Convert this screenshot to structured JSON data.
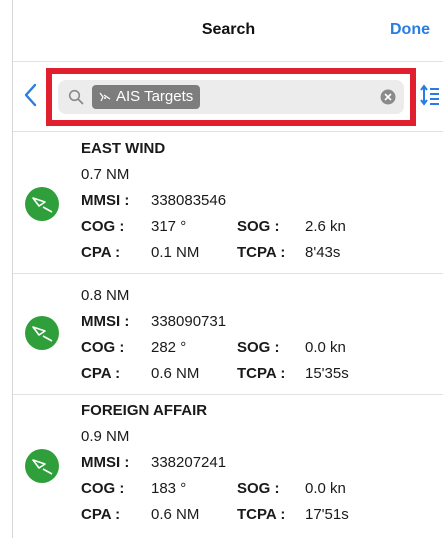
{
  "navbar": {
    "title": "Search",
    "done_label": "Done"
  },
  "search": {
    "token_label": "AIS Targets",
    "token_icon": "ais-vessel-icon"
  },
  "colors": {
    "accent": "#2a7be4",
    "highlight": "#e0202e",
    "target": "#2e9f3a",
    "token": "#7d7d7d"
  },
  "labels": {
    "mmsi": "MMSI :",
    "cog": "COG :",
    "sog": "SOG :",
    "cpa": "CPA :",
    "tcpa": "TCPA :"
  },
  "targets": [
    {
      "name": "EAST WIND",
      "distance": "0.7 NM",
      "mmsi": "338083546",
      "cog": "317 °",
      "sog": "2.6 kn",
      "cpa": "0.1 NM",
      "tcpa": "8'43s"
    },
    {
      "name": "",
      "distance": "0.8 NM",
      "mmsi": "338090731",
      "cog": "282 °",
      "sog": "0.0 kn",
      "cpa": "0.6 NM",
      "tcpa": "15'35s"
    },
    {
      "name": "FOREIGN AFFAIR",
      "distance": "0.9 NM",
      "mmsi": "338207241",
      "cog": "183 °",
      "sog": "0.0 kn",
      "cpa": "0.6 NM",
      "tcpa": "17'51s"
    }
  ]
}
